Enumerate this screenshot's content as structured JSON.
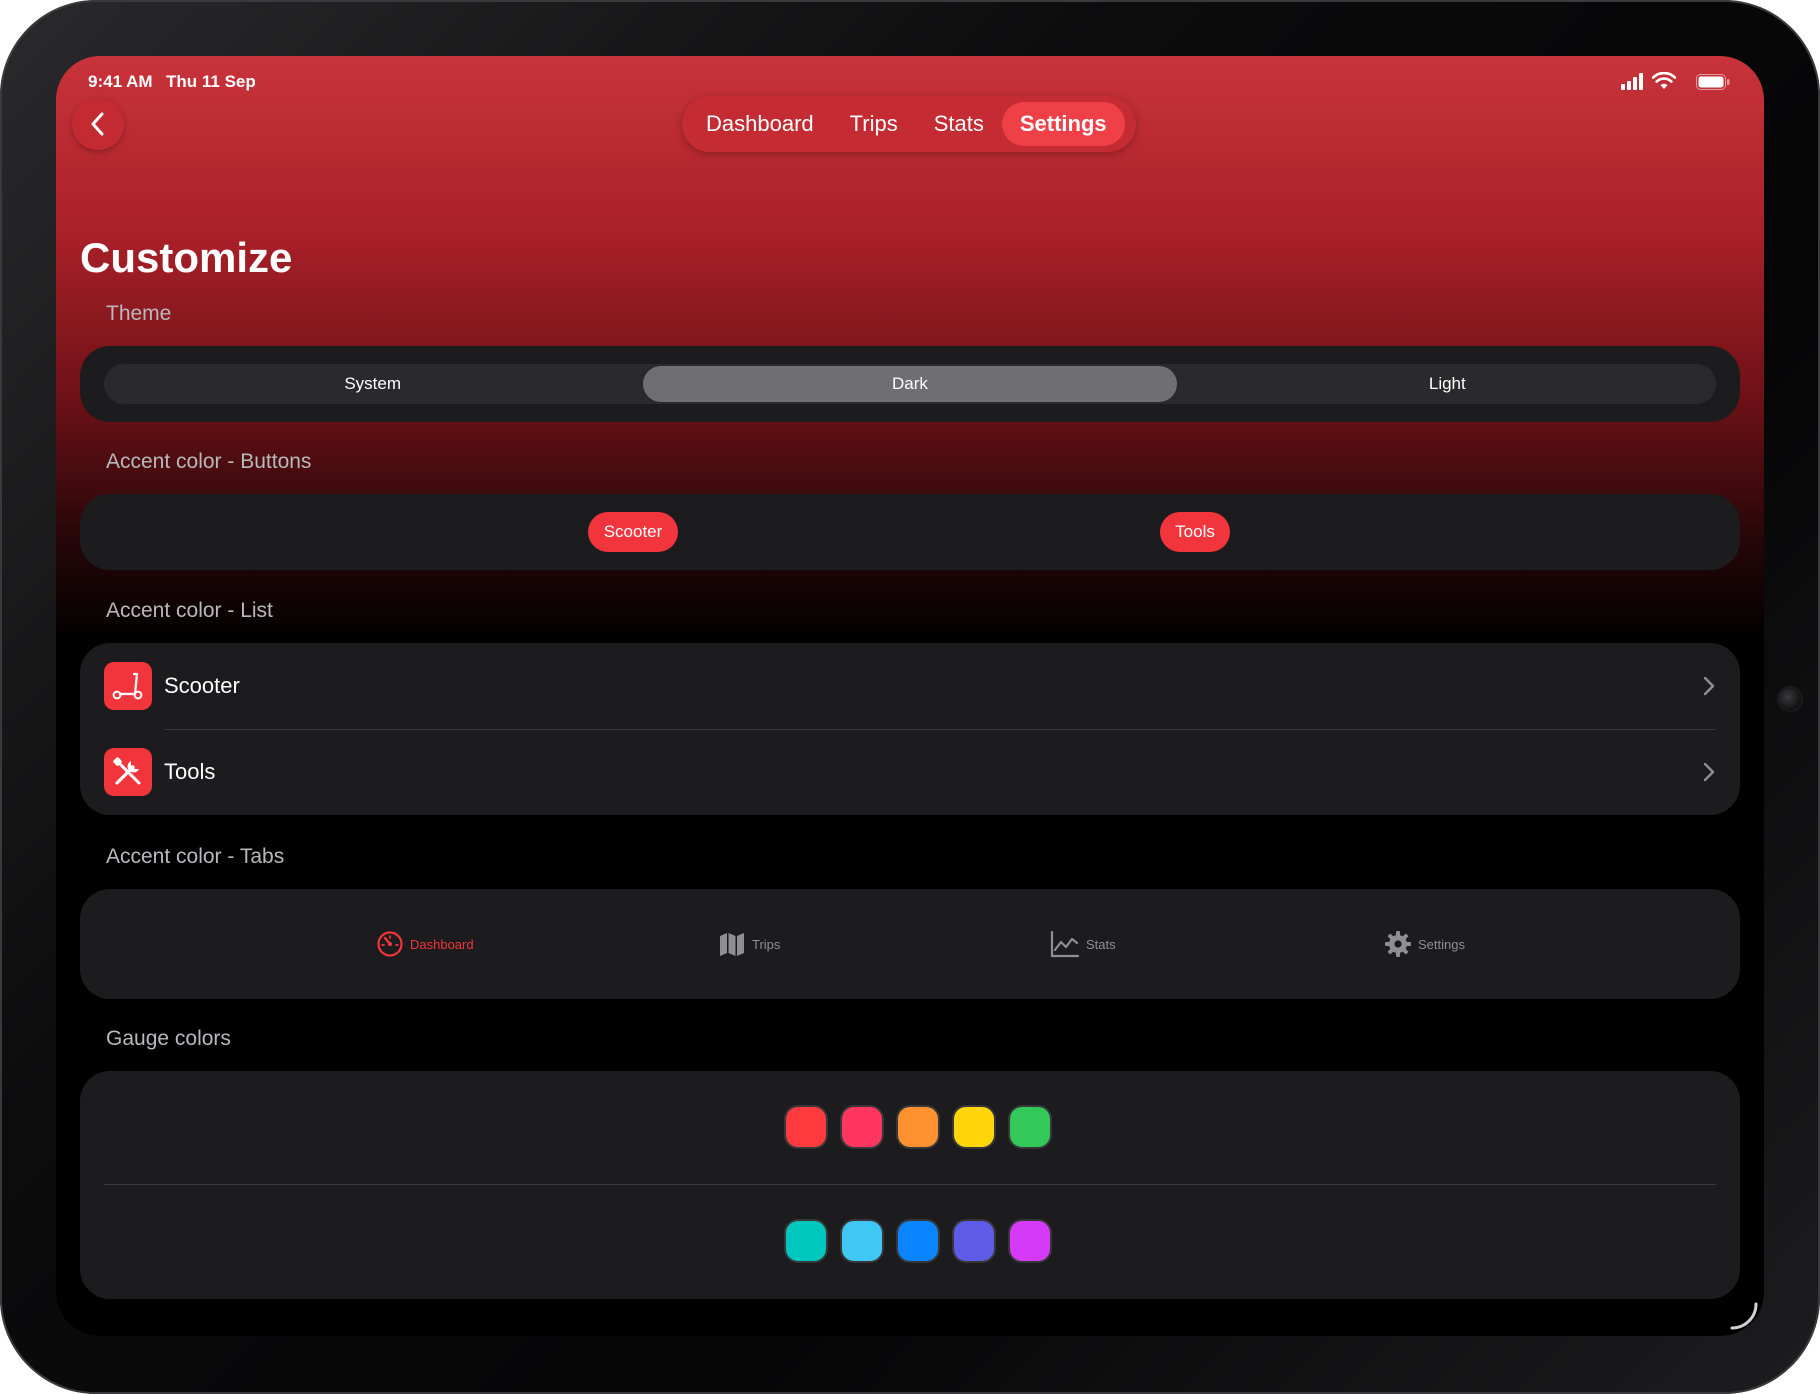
{
  "status_bar": {
    "time": "9:41 AM",
    "date": "Thu 11 Sep"
  },
  "nav": {
    "tabs": [
      {
        "label": "Dashboard",
        "active": false
      },
      {
        "label": "Trips",
        "active": false
      },
      {
        "label": "Stats",
        "active": false
      },
      {
        "label": "Settings",
        "active": true
      }
    ]
  },
  "page": {
    "title": "Customize"
  },
  "theme": {
    "label": "Theme",
    "options": [
      "System",
      "Dark",
      "Light"
    ],
    "selected": "Dark"
  },
  "accent_buttons": {
    "label": "Accent color - Buttons",
    "buttons": [
      "Scooter",
      "Tools"
    ]
  },
  "accent_list": {
    "label": "Accent color - List",
    "items": [
      {
        "label": "Scooter",
        "icon": "scooter-icon"
      },
      {
        "label": "Tools",
        "icon": "tools-icon"
      }
    ]
  },
  "accent_tabs": {
    "label": "Accent color - Tabs",
    "tabs": [
      {
        "label": "Dashboard",
        "icon": "speedometer-icon",
        "active": true
      },
      {
        "label": "Trips",
        "icon": "map-icon",
        "active": false
      },
      {
        "label": "Stats",
        "icon": "chart-icon",
        "active": false
      },
      {
        "label": "Settings",
        "icon": "gear-icon",
        "active": false
      }
    ]
  },
  "gauge_colors": {
    "label": "Gauge colors",
    "row1": [
      "#ff3b3f",
      "#ff375f",
      "#ff9230",
      "#ffd60a",
      "#34c759"
    ],
    "row2": [
      "#00c7be",
      "#40c8f5",
      "#0a84ff",
      "#5e5ce6",
      "#d63af9"
    ]
  },
  "colors": {
    "accent": "#f2353c",
    "inactive_tab": "#8e8e93",
    "card": "#1c1c1e"
  }
}
